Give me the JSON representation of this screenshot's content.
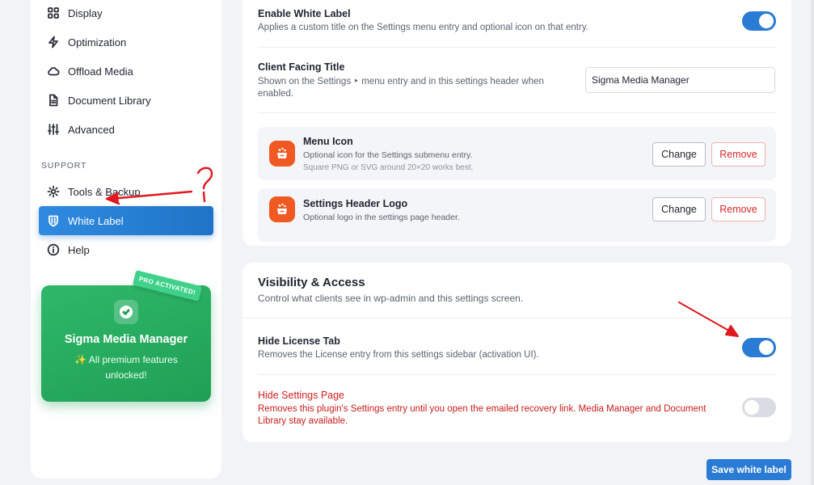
{
  "sidebar": {
    "items": [
      {
        "label": "Display",
        "icon": "grid-icon"
      },
      {
        "label": "Optimization",
        "icon": "bolt-icon"
      },
      {
        "label": "Offload Media",
        "icon": "cloud-icon"
      },
      {
        "label": "Document Library",
        "icon": "document-icon"
      },
      {
        "label": "Advanced",
        "icon": "sliders-icon"
      }
    ],
    "support_label": "SUPPORT",
    "support_items": [
      {
        "label": "Tools & Backup",
        "icon": "gear-icon"
      },
      {
        "label": "White Label",
        "icon": "shield-icon",
        "active": true
      },
      {
        "label": "Help",
        "icon": "info-icon"
      }
    ],
    "promo": {
      "badge": "PRO ACTIVATED!",
      "title": "Sigma Media Manager",
      "subtitle": "✨ All premium features unlocked!"
    }
  },
  "white_label": {
    "enable": {
      "title": "Enable White Label",
      "description": "Applies a custom title on the Settings menu entry and optional icon on that entry.",
      "enabled": true
    },
    "client_title": {
      "title": "Client Facing Title",
      "description": "Shown on the Settings ‣ menu entry and in this settings header when enabled.",
      "value": "Sigma Media Manager"
    },
    "menu_icon": {
      "title": "Menu Icon",
      "description": "Optional icon for the Settings submenu entry.",
      "hint": "Square PNG or SVG around 20×20 works best.",
      "change_label": "Change",
      "remove_label": "Remove"
    },
    "header_logo": {
      "title": "Settings Header Logo",
      "description": "Optional logo in the settings page header.",
      "change_label": "Change",
      "remove_label": "Remove"
    }
  },
  "visibility": {
    "title": "Visibility & Access",
    "description": "Control what clients see in wp-admin and this settings screen.",
    "hide_license": {
      "title": "Hide License Tab",
      "description": "Removes the License entry from this settings sidebar (activation UI).",
      "enabled": true
    },
    "hide_settings": {
      "title": "Hide Settings Page",
      "description": "Removes this plugin's Settings entry until you open the emailed recovery link. Media Manager and Document Library stay available.",
      "enabled": false
    }
  },
  "save_label": "Save white label",
  "colors": {
    "accent": "#2a7bd3",
    "danger": "#d0211e",
    "promo": "#1f9f55",
    "icon_orange": "#f05a22",
    "annotation": "#e0191f"
  }
}
